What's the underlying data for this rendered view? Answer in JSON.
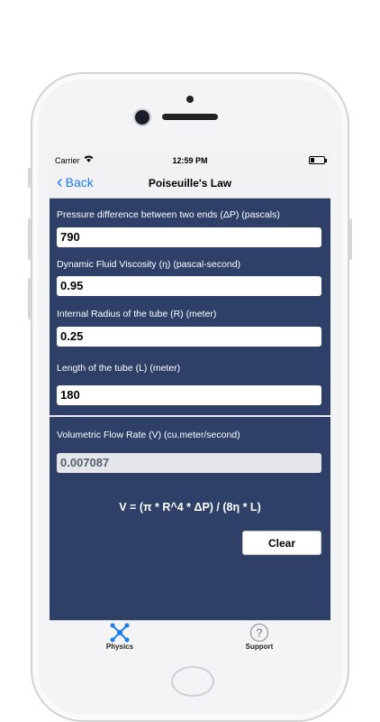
{
  "status": {
    "carrier": "Carrier",
    "time": "12:59 PM"
  },
  "nav": {
    "back_label": "Back",
    "title": "Poiseuille's Law"
  },
  "fields": [
    {
      "label": "Pressure difference between two ends (ΔP) (pascals)",
      "value": "790"
    },
    {
      "label": "Dynamic Fluid Viscosity (η) (pascal-second)",
      "value": "0.95"
    },
    {
      "label": "Internal Radius of the tube (R) (meter)",
      "value": "0.25"
    },
    {
      "label": "Length of the tube (L) (meter)",
      "value": "180"
    }
  ],
  "result": {
    "label": "Volumetric Flow Rate (V) (cu.meter/second)",
    "value": "0.007087"
  },
  "formula": "V = (π * R^4 * ΔP) / (8η * L)",
  "clear_label": "Clear",
  "tabs": [
    {
      "label": "Physics",
      "icon": "physics-icon",
      "color": "#1a7cf5"
    },
    {
      "label": "Support",
      "icon": "help-icon",
      "color": "#9a9a9f"
    }
  ],
  "colors": {
    "background": "#2e4068",
    "accent": "#1a7cf5"
  }
}
